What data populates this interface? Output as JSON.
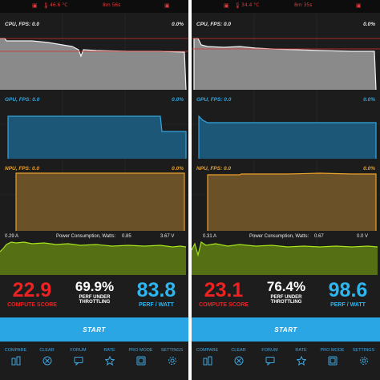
{
  "colors": {
    "cpu": "#d8d8d8",
    "gpu": "#33a5e0",
    "npu": "#eaa02a",
    "power": "#a6e41c",
    "compute": "#ee2222",
    "perf_watt": "#2db6f0",
    "nav": "#3ea6e0",
    "status": "#e23a3a"
  },
  "nav": [
    "COMPARE",
    "CLEAR",
    "FORUM",
    "RATE",
    "PRO MODE",
    "SETTINGS"
  ],
  "nav_icons": [
    "compare-icon",
    "clear-icon",
    "forum-icon",
    "rate-star-icon",
    "pro-mode-icon",
    "settings-gear-icon"
  ],
  "panels": [
    {
      "status": {
        "temperature": "46.6 °C",
        "time": "8m 56s"
      },
      "cpu": {
        "label": "CPU, FPS: 0.0",
        "value": "0.0%"
      },
      "gpu": {
        "label": "GPU, FPS: 0.0",
        "value": "0.0%"
      },
      "npu": {
        "label": "NPU, FPS: 0.0",
        "value": "0.0%"
      },
      "power": {
        "current": "0.29 A",
        "title": "Power Consumption, Watts:",
        "watts": "0.85",
        "voltage": "3.67 V"
      },
      "scores": {
        "compute": {
          "value": "22.9",
          "label": "COMPUTE SCORE"
        },
        "throttling": {
          "value": "69.9%",
          "label_lines": [
            "PERF UNDER",
            "THROTTLING"
          ]
        },
        "perf_watt": {
          "value": "83.8",
          "label": "PERF / WATT"
        }
      },
      "start": "START"
    },
    {
      "status": {
        "temperature": "34.4 °C",
        "time": "8m 35s"
      },
      "cpu": {
        "label": "CPU, FPS: 0.0",
        "value": "0.0%"
      },
      "gpu": {
        "label": "GPU, FPS: 0.0",
        "value": "0.0%"
      },
      "npu": {
        "label": "NPU, FPS: 0.0",
        "value": "0.0%"
      },
      "power": {
        "current": "0.31 A",
        "title": "Power Consumption, Watts:",
        "watts": "0.67",
        "voltage": "0.0 V"
      },
      "scores": {
        "compute": {
          "value": "23.1",
          "label": "COMPUTE SCORE"
        },
        "throttling": {
          "value": "76.4%",
          "label_lines": [
            "PERF UNDER",
            "THROTTLING"
          ]
        },
        "perf_watt": {
          "value": "98.6",
          "label": "PERF / WATT"
        }
      },
      "start": "START"
    }
  ]
}
